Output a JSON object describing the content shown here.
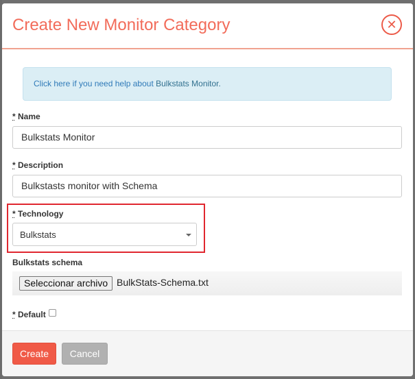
{
  "modal": {
    "title": "Create New Monitor Category",
    "close_icon": "close-icon"
  },
  "help": {
    "link_text": "Click here if you need help about",
    "subject": "Bulkstats Monitor."
  },
  "form": {
    "name": {
      "required_mark": "*",
      "label": "Name",
      "value": "Bulkstats Monitor"
    },
    "description": {
      "required_mark": "*",
      "label": "Description",
      "value": "Bulkstasts monitor with Schema"
    },
    "technology": {
      "required_mark": "*",
      "label": "Technology",
      "selected": "Bulkstats"
    },
    "schema": {
      "label": "Bulkstats schema",
      "button_label": "Seleccionar archivo",
      "file_name": "BulkStats-Schema.txt"
    },
    "default": {
      "required_mark": "*",
      "label": "Default",
      "checked": false
    }
  },
  "footer": {
    "create_label": "Create",
    "cancel_label": "Cancel"
  },
  "colors": {
    "accent": "#f26c5a",
    "highlight": "#e0262e",
    "alert_bg": "#dbeef5"
  }
}
